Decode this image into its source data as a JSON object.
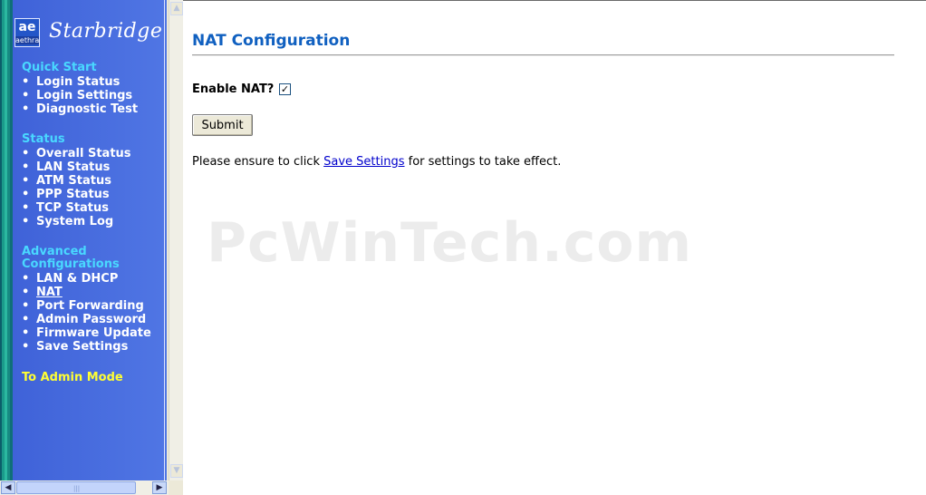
{
  "brand": {
    "logo_mark": "ae",
    "logo_sub": "aethra",
    "name": "Starbridge"
  },
  "sidebar": {
    "sections": [
      {
        "title": "Quick Start",
        "items": [
          {
            "label": "Login Status"
          },
          {
            "label": "Login Settings"
          },
          {
            "label": "Diagnostic Test"
          }
        ]
      },
      {
        "title": "Status",
        "items": [
          {
            "label": "Overall Status"
          },
          {
            "label": "LAN Status"
          },
          {
            "label": "ATM Status"
          },
          {
            "label": "PPP Status"
          },
          {
            "label": "TCP Status"
          },
          {
            "label": "System Log"
          }
        ]
      },
      {
        "title_line1": "Advanced",
        "title_line2": "Configurations",
        "items": [
          {
            "label": "LAN & DHCP"
          },
          {
            "label": "NAT",
            "active": true
          },
          {
            "label": "Port Forwarding"
          },
          {
            "label": "Admin Password"
          },
          {
            "label": "Firmware Update"
          },
          {
            "label": "Save Settings"
          }
        ]
      }
    ],
    "admin_mode": "To Admin Mode",
    "bullet": "•"
  },
  "main": {
    "title": "NAT Configuration",
    "enable_nat_label": "Enable NAT?",
    "enable_nat_checked": true,
    "submit_label": "Submit",
    "notice_before": "Please ensure to click ",
    "notice_link": "Save Settings",
    "notice_after": " for settings to take effect.",
    "watermark": "PcWinTech.com"
  },
  "colors": {
    "sidebar_bg": "#4a6ee0",
    "section_title": "#49d8ff",
    "admin_mode": "#ffff33",
    "page_title": "#1060c0",
    "link": "#0000cc"
  }
}
